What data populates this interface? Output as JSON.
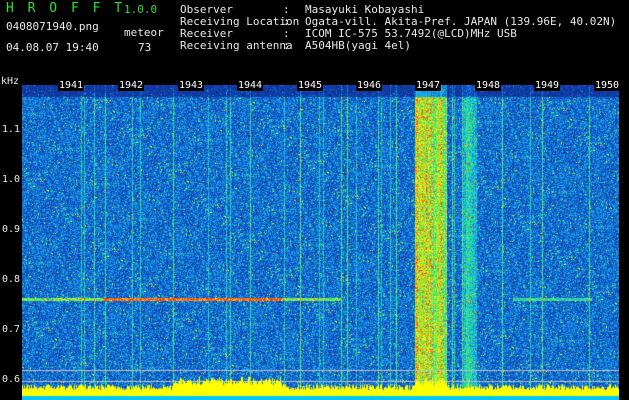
{
  "header": {
    "app_name": "H R O F F T",
    "app_version": "1.0.0",
    "file_name": "0408071940.png",
    "timestamp": "04.08.07 19:40",
    "detect_type": "meteor",
    "detect_count": "73",
    "fields": [
      {
        "label": "Observer",
        "value": "Masayuki Kobayashi"
      },
      {
        "label": "Receiving Location",
        "value": "Ogata-vill. Akita-Pref. JAPAN (139.96E, 40.02N)"
      },
      {
        "label": "Receiver",
        "value": "ICOM IC-575 53.7492(@LCD)MHz USB"
      },
      {
        "label": "Receiving antenna",
        "value": "A504HB(yagi 4el)"
      }
    ]
  },
  "plot": {
    "y_unit": "kHz",
    "y_ticks": [
      "1.1",
      "1.0",
      "0.9",
      "0.8",
      "0.7",
      "0.6"
    ],
    "x_ticks": [
      "1941",
      "1942",
      "1943",
      "1944",
      "1945",
      "1946",
      "1947",
      "1948",
      "1949",
      "1950"
    ]
  },
  "colors": {
    "background": "#000000",
    "spectrogram_base": "#1a3fb0",
    "trace": "#ffff00",
    "floor": "#00c8ff",
    "title": "#30e030"
  }
}
